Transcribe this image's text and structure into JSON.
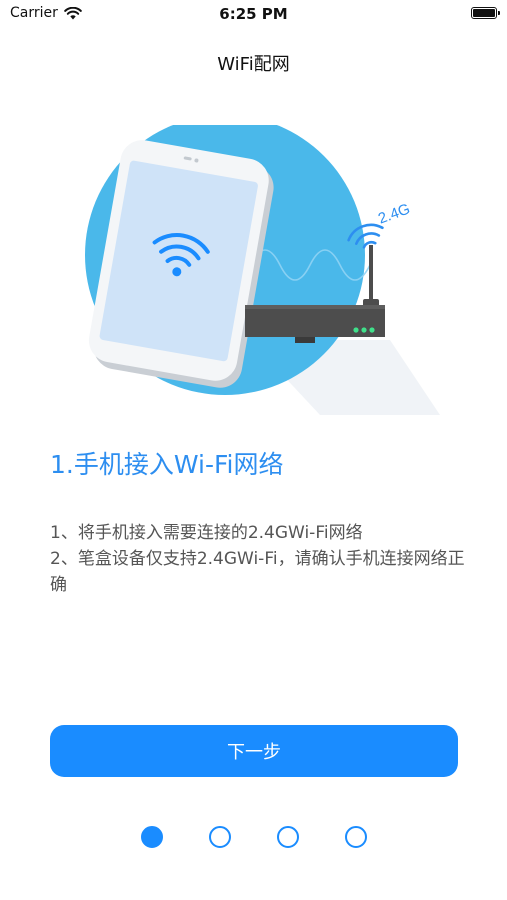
{
  "status_bar": {
    "carrier": "Carrier",
    "time": "6:25 PM",
    "wifi_icon": "wifi-icon",
    "battery_level": 1.0
  },
  "nav": {
    "title": "WiFi配网"
  },
  "illustration": {
    "band_label": "2.4G",
    "colors": {
      "circle": "#4ab8ea",
      "phone_screen": "#cfe3f8",
      "router": "#4d4d4d",
      "router_leds": "#3fe08a",
      "signal": "#2d8ef0"
    }
  },
  "step": {
    "title": "1.手机接入Wi-Fi网络",
    "instructions": [
      "1、将手机接入需要连接的2.4GWi-Fi网络",
      "2、笔盒设备仅支持2.4GWi-Fi，请确认手机连接网络正确"
    ]
  },
  "actions": {
    "next_label": "下一步"
  },
  "pager": {
    "total": 4,
    "current": 1
  },
  "colors": {
    "accent": "#1a8cff",
    "title": "#2d8ef0",
    "body_text": "#555555"
  }
}
